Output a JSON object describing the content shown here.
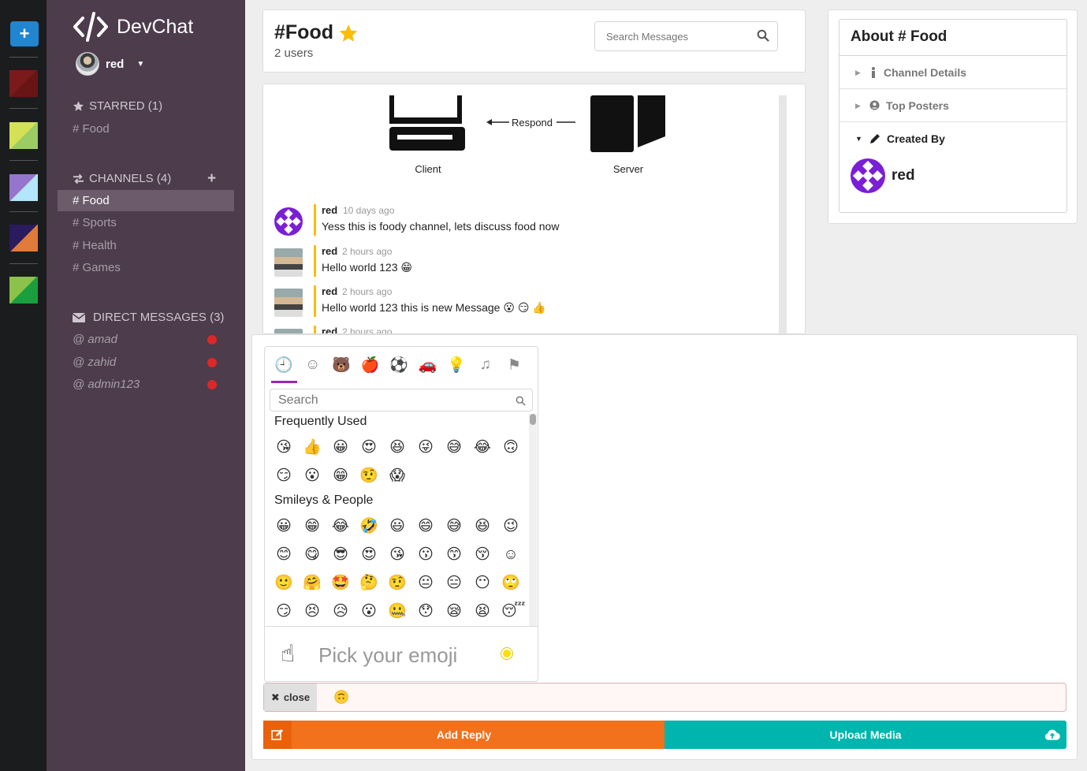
{
  "rail": {
    "add_label": "+",
    "swatches": [
      {
        "c1": "#7b1a1a",
        "c2": "#6a1515"
      },
      {
        "c1": "#d4e157",
        "c2": "#9ccc65"
      },
      {
        "c1": "#9575cd",
        "c2": "#b3e5fc"
      },
      {
        "c1": "#2a1a5e",
        "c2": "#e07b39"
      },
      {
        "c1": "#8bc34a",
        "c2": "#1b9e3e"
      }
    ]
  },
  "sidebar": {
    "brand": "DevChat",
    "username": "red",
    "starred_header": "STARRED (1)",
    "starred": [
      "# Food"
    ],
    "channels_header": "CHANNELS (4)",
    "channels": [
      "# Food",
      "# Sports",
      "# Health",
      "# Games"
    ],
    "dm_header": "DIRECT MESSAGES (3)",
    "dms": [
      "@ amad",
      "@ zahid",
      "@ admin123"
    ]
  },
  "header": {
    "channel": "#Food",
    "users": "2 users",
    "search_placeholder": "Search Messages"
  },
  "diagram": {
    "respond": "Respond",
    "client": "Client",
    "server": "Server"
  },
  "messages": [
    {
      "author": "red",
      "time": "10 days ago",
      "text": "Yess this is foody channel, lets discuss food now",
      "avatar": "pattern"
    },
    {
      "author": "red",
      "time": "2 hours ago",
      "text": "Hello world 123 😁",
      "avatar": "photo"
    },
    {
      "author": "red",
      "time": "2 hours ago",
      "text": "Hello world 123 this is new Message 😮 😏 👍",
      "avatar": "photo"
    },
    {
      "author": "red",
      "time": "2 hours ago",
      "text": "",
      "avatar": "photo"
    }
  ],
  "about": {
    "title": "About # Food",
    "channel_details": "Channel Details",
    "top_posters": "Top Posters",
    "created_by": "Created By",
    "creator": "red"
  },
  "emoji_picker": {
    "search_placeholder": "Search",
    "frequently_used": "Frequently Used",
    "smileys": "Smileys & People",
    "preview": "Pick your emoji",
    "categories": [
      "🕘",
      "☺",
      "🐻",
      "🍎",
      "⚽",
      "🚗",
      "💡",
      "♫",
      "⚑"
    ],
    "frequent": [
      "😘",
      "👍",
      "😀",
      "😍",
      "😆",
      "😜",
      "😅",
      "😂",
      "🙃",
      "😏",
      "😮",
      "😁",
      "🤨",
      "😱"
    ],
    "smiley_rows": [
      [
        "😀",
        "😁",
        "😂",
        "🤣",
        "😃",
        "😄",
        "😅",
        "😆",
        "😉"
      ],
      [
        "😊",
        "😋",
        "😎",
        "😍",
        "😘",
        "😗",
        "😙",
        "😚",
        "☺"
      ],
      [
        "🙂",
        "🤗",
        "🤩",
        "🤔",
        "🤨",
        "😐",
        "😑",
        "😶",
        "🙄"
      ],
      [
        "😏",
        "😣",
        "😥",
        "😮",
        "🤐",
        "😯",
        "😪",
        "😫",
        "😴"
      ]
    ]
  },
  "reply": {
    "close_label": "close",
    "value": "🙃",
    "add_reply": "Add Reply",
    "upload_media": "Upload Media"
  }
}
